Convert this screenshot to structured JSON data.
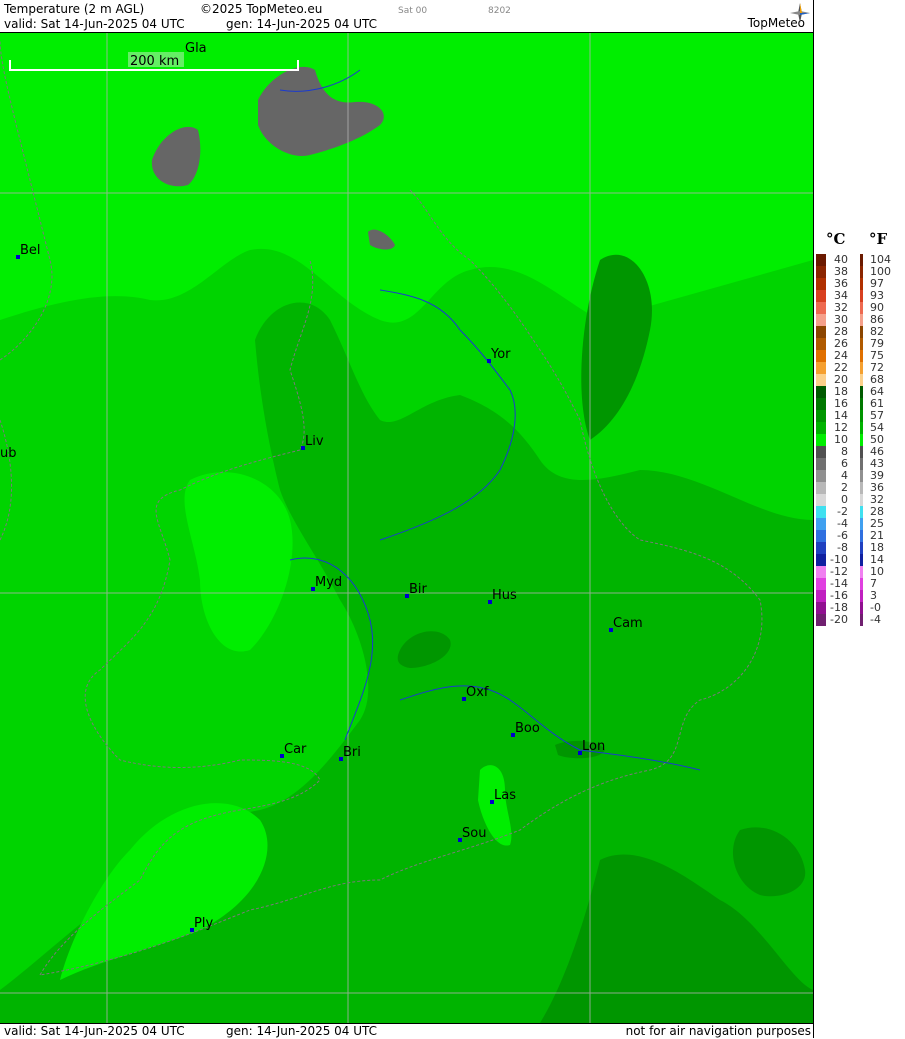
{
  "header": {
    "product": "Temperature (2 m AGL)",
    "copyright": "©2025 TopMeteo.eu",
    "valid": "valid:  Sat  14-Jun-2025  04 UTC",
    "generated": "gen: 14-Jun-2025 04 UTC",
    "run_label": "Sat 00",
    "code": "8202",
    "brand": "TopMeteo"
  },
  "footer": {
    "valid": "valid:  Sat  14-Jun-2025  04 UTC",
    "generated": "gen: 14-Jun-2025 04 UTC",
    "notice": "not for air navigation purposes"
  },
  "map": {
    "scale_bar_label": "200 km",
    "cities": [
      {
        "name": "Gla"
      },
      {
        "name": "Bel"
      },
      {
        "name": "Yor"
      },
      {
        "name": "Liv"
      },
      {
        "name": "ub"
      },
      {
        "name": "Myd"
      },
      {
        "name": "Bir"
      },
      {
        "name": "Hus"
      },
      {
        "name": "Cam"
      },
      {
        "name": "Oxf"
      },
      {
        "name": "Boo"
      },
      {
        "name": "Lon"
      },
      {
        "name": "Car"
      },
      {
        "name": "Bri"
      },
      {
        "name": "Las"
      },
      {
        "name": "Sou"
      },
      {
        "name": "Ply"
      }
    ],
    "colors": {
      "temp_10_12": "#00ee00",
      "temp_12_14": "#00d400",
      "temp_14_16": "#00b400",
      "temp_16_18": "#009600",
      "cold_6_8": "#666666",
      "marker": "#0000cc"
    }
  },
  "legend": {
    "celsius_label": "°C",
    "fahrenheit_label": "°F",
    "rows": [
      {
        "c": "40",
        "f": "104",
        "color": "#6b1a00"
      },
      {
        "c": "38",
        "f": "100",
        "color": "#8b2500"
      },
      {
        "c": "36",
        "f": "97",
        "color": "#b03000"
      },
      {
        "c": "34",
        "f": "93",
        "color": "#d84020"
      },
      {
        "c": "32",
        "f": "90",
        "color": "#ee6a50"
      },
      {
        "c": "30",
        "f": "86",
        "color": "#f5a08a"
      },
      {
        "c": "28",
        "f": "82",
        "color": "#8b4500"
      },
      {
        "c": "26",
        "f": "79",
        "color": "#b05a00"
      },
      {
        "c": "24",
        "f": "75",
        "color": "#e07000"
      },
      {
        "c": "22",
        "f": "72",
        "color": "#f5a030"
      },
      {
        "c": "20",
        "f": "68",
        "color": "#fcd08a"
      },
      {
        "c": "18",
        "f": "64",
        "color": "#005a00"
      },
      {
        "c": "16",
        "f": "61",
        "color": "#007800"
      },
      {
        "c": "14",
        "f": "57",
        "color": "#009600"
      },
      {
        "c": "12",
        "f": "54",
        "color": "#00b400"
      },
      {
        "c": "10",
        "f": "50",
        "color": "#00ee00"
      },
      {
        "c": "8",
        "f": "46",
        "color": "#505050"
      },
      {
        "c": "6",
        "f": "43",
        "color": "#707070"
      },
      {
        "c": "4",
        "f": "39",
        "color": "#909090"
      },
      {
        "c": "2",
        "f": "36",
        "color": "#b8b8b8"
      },
      {
        "c": "0",
        "f": "32",
        "color": "#d8d8d8"
      },
      {
        "c": "-2",
        "f": "28",
        "color": "#40e0f0"
      },
      {
        "c": "-4",
        "f": "25",
        "color": "#40a0f0"
      },
      {
        "c": "-6",
        "f": "21",
        "color": "#3070e0"
      },
      {
        "c": "-8",
        "f": "18",
        "color": "#2040c0"
      },
      {
        "c": "-10",
        "f": "14",
        "color": "#1020a0"
      },
      {
        "c": "-12",
        "f": "10",
        "color": "#f080f0"
      },
      {
        "c": "-14",
        "f": "7",
        "color": "#e040e0"
      },
      {
        "c": "-16",
        "f": "3",
        "color": "#c020c0"
      },
      {
        "c": "-18",
        "f": "-0",
        "color": "#901090"
      },
      {
        "c": "-20",
        "f": "-4",
        "color": "#702070"
      }
    ]
  }
}
